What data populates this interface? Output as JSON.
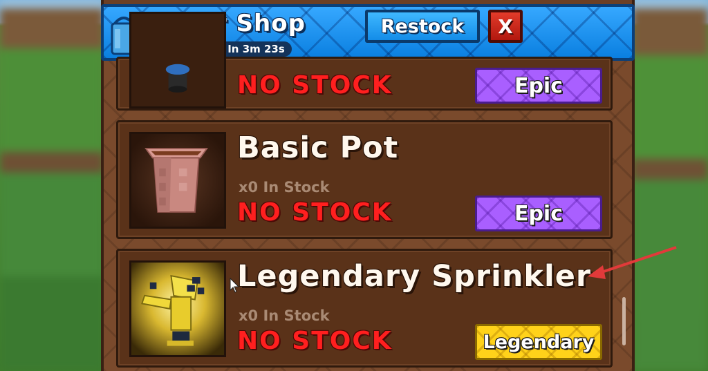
{
  "header": {
    "title": "Gear Shop",
    "timer": "Restock In 3m 23s",
    "restock_label": "Restock",
    "close_label": "X"
  },
  "items": [
    {
      "name": "",
      "stock": "",
      "status": "NO STOCK",
      "rarity": "Epic",
      "rarity_color": "#a95fff",
      "icon": "sprinkler-partial-icon"
    },
    {
      "name": "Basic Pot",
      "stock": "x0 In Stock",
      "status": "NO STOCK",
      "rarity": "Epic",
      "rarity_color": "#a95fff",
      "icon": "basic-pot-icon"
    },
    {
      "name": "Legendary Sprinkler",
      "stock": "x0 In Stock",
      "status": "NO STOCK",
      "rarity": "Legendary",
      "rarity_color": "#ffd21a",
      "icon": "legendary-sprinkler-icon"
    }
  ],
  "colors": {
    "header_blue": "#0f8ff0",
    "panel_brown": "#7a4a2c",
    "no_stock_red": "#ff1f1f",
    "annotation_arrow": "#e23a3a"
  }
}
